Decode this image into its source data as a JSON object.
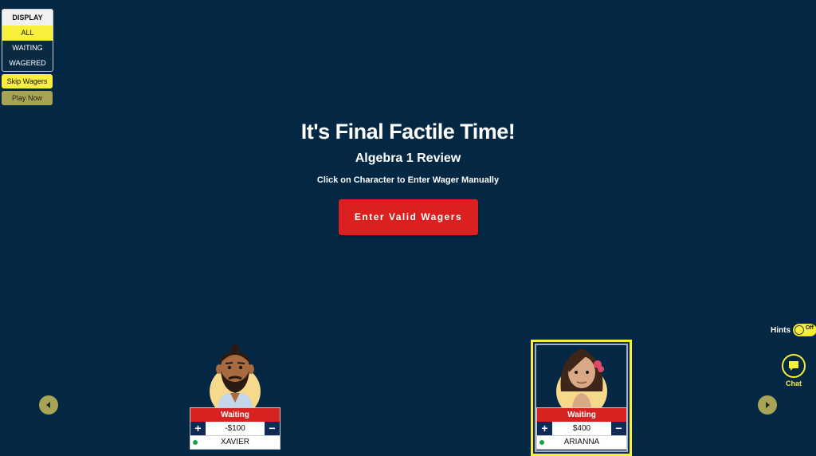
{
  "display": {
    "header": "DISPLAY",
    "options": [
      "ALL",
      "WAITING",
      "WAGERED"
    ]
  },
  "buttons": {
    "skip_wagers": "Skip Wagers",
    "play_now": "Play Now",
    "enter_valid_wagers": "Enter Valid Wagers"
  },
  "heading": {
    "title": "It's Final Factile Time!",
    "subtitle": "Algebra 1 Review",
    "instruction": "Click on Character to Enter Wager Manually"
  },
  "hints": {
    "label": "Hints",
    "toggle": "Off"
  },
  "chat": {
    "label": "Chat"
  },
  "players": [
    {
      "name": "XAVIER",
      "status": "Waiting",
      "wager": "-$100",
      "plus": "+",
      "minus": "−"
    },
    {
      "name": "ARIANNA",
      "status": "Waiting",
      "wager": "$400",
      "plus": "+",
      "minus": "−"
    }
  ],
  "colors": {
    "background": "#042843",
    "accent": "#f7ef3b",
    "primary_button": "#dc1f1f"
  }
}
